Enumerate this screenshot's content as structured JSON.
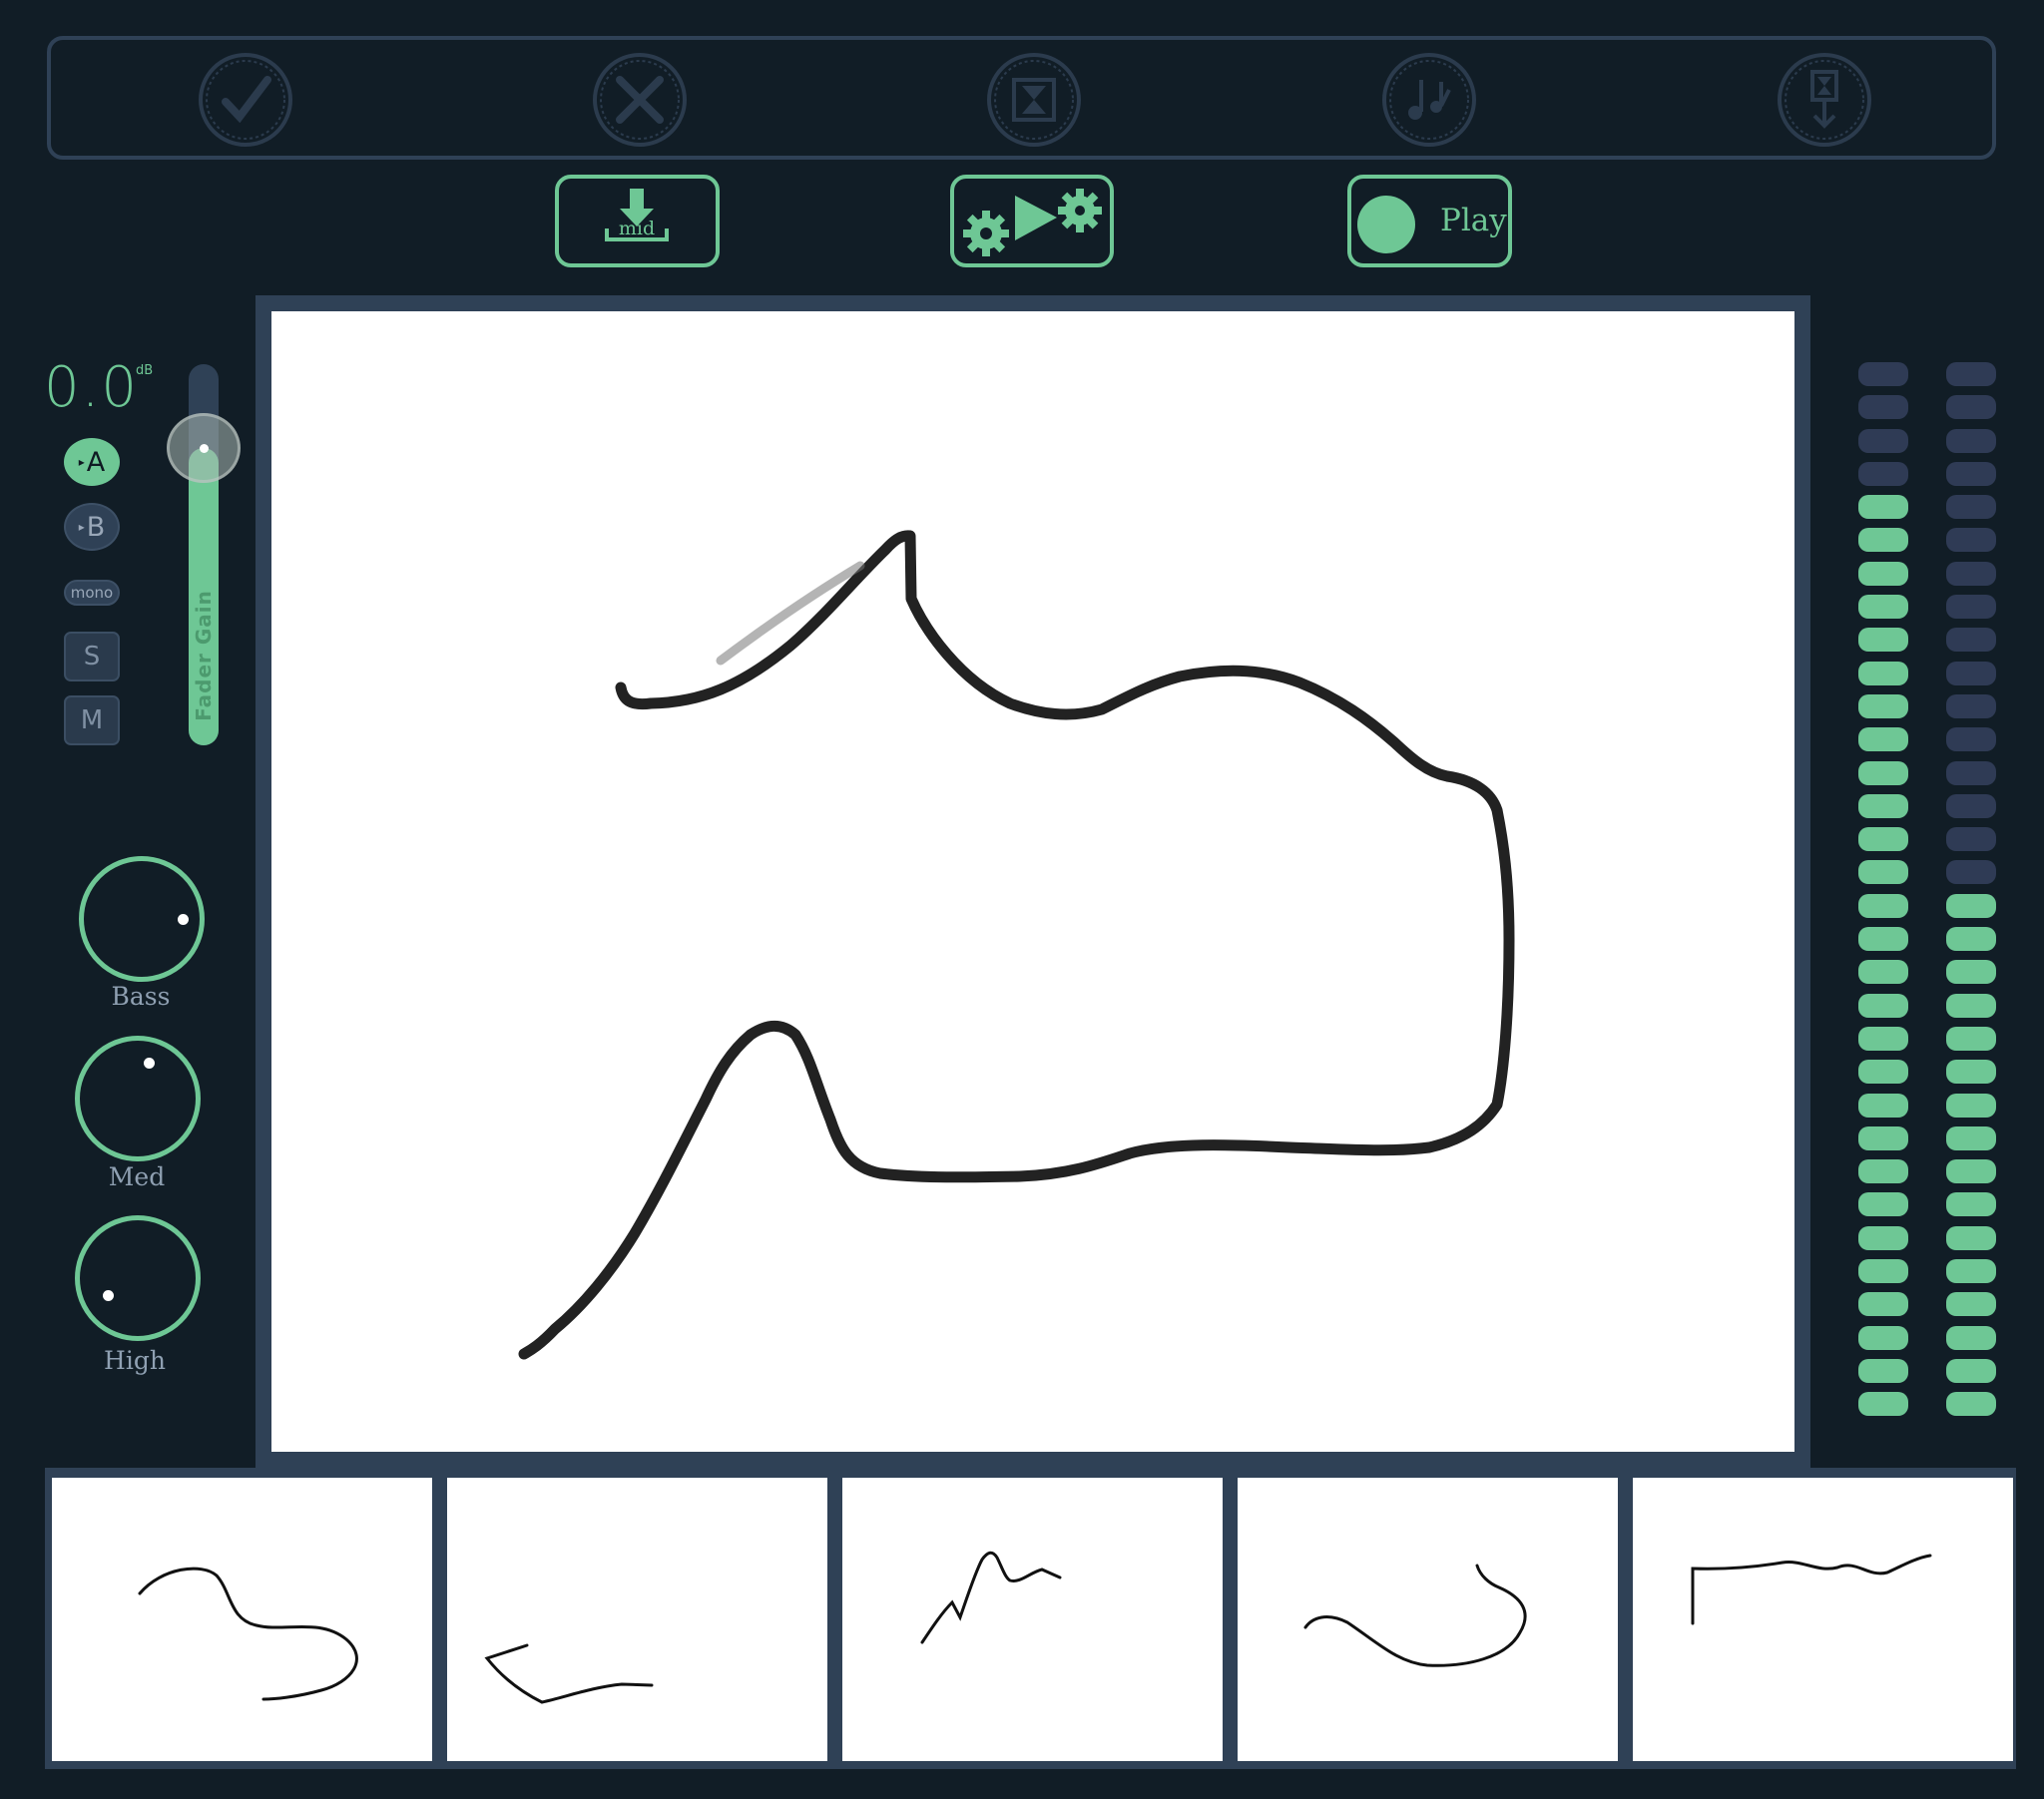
{
  "toolbar": {
    "buttons": [
      {
        "name": "confirm",
        "icon": "check-icon"
      },
      {
        "name": "cancel",
        "icon": "x-icon"
      },
      {
        "name": "hourglass",
        "icon": "hourglass-icon"
      },
      {
        "name": "music",
        "icon": "music-note-icon"
      },
      {
        "name": "hourglass-download",
        "icon": "hourglass-download-icon"
      }
    ]
  },
  "actions": {
    "download_label": "mid",
    "play_label": "Play"
  },
  "channel": {
    "gain_value": "0.0",
    "gain_unit": "dB",
    "fader_label": "Fader Gain",
    "fader_level": 0.78,
    "button_a": "A",
    "button_b": "B",
    "mono_label": "mono",
    "solo_label": "S",
    "mute_label": "M",
    "active_input": "A"
  },
  "eq": [
    {
      "label": "Bass"
    },
    {
      "label": "Med"
    },
    {
      "label": "High"
    }
  ],
  "meters": {
    "segments": 32,
    "left_lit": 28,
    "right_lit": 16
  },
  "colors": {
    "background": "#111d26",
    "panel": "#2f4156",
    "accent": "#6ec795",
    "meter_off": "#2f3b55",
    "canvas": "#ffffff",
    "stroke": "#222222"
  },
  "thumbnails": {
    "count": 5
  }
}
